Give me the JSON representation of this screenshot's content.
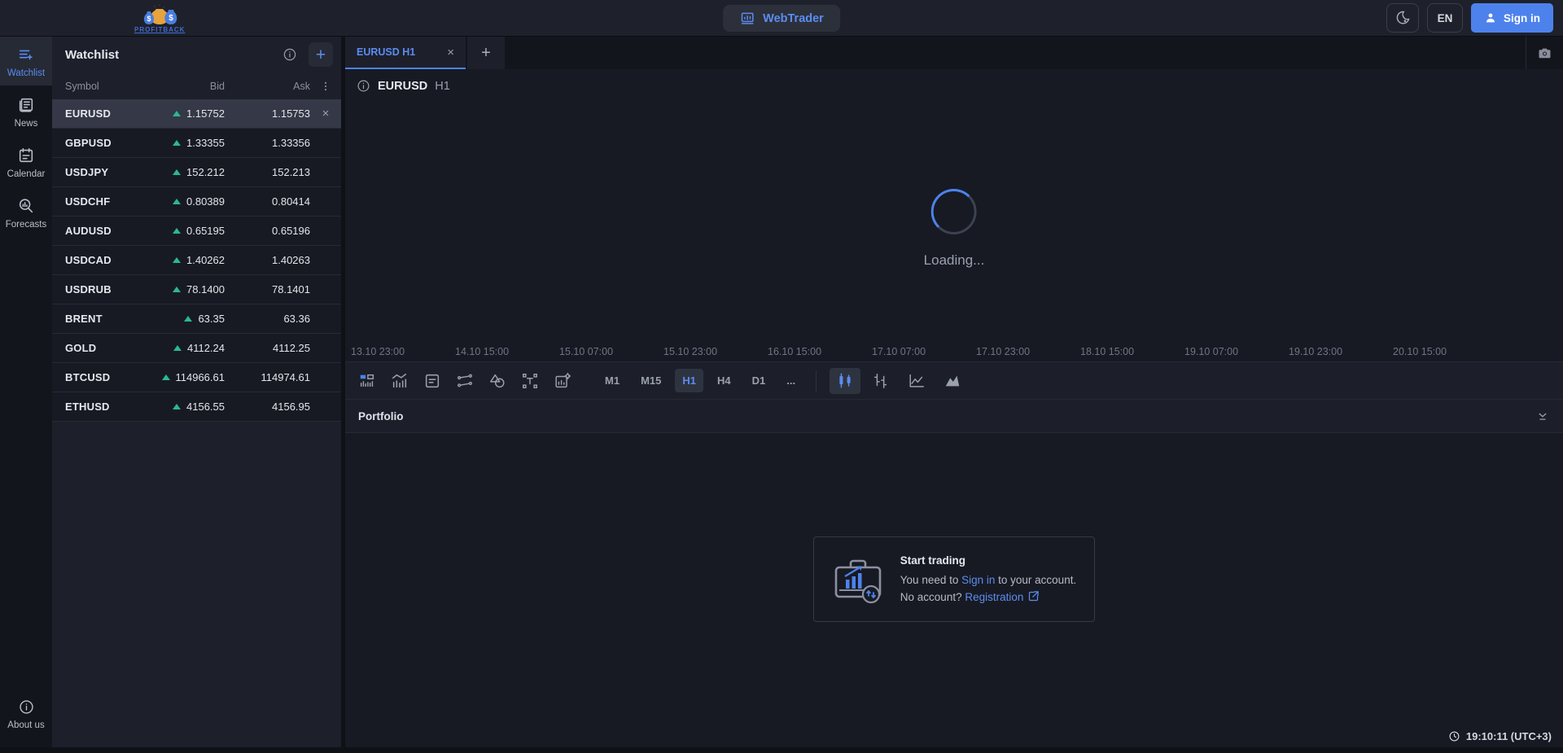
{
  "topbar": {
    "brand_caption": "PROFITBACK",
    "webtrader_label": "WebTrader",
    "language_label": "EN",
    "signin_label": "Sign in"
  },
  "sidebar": {
    "items": [
      {
        "id": "watchlist",
        "label": "Watchlist",
        "active": true
      },
      {
        "id": "news",
        "label": "News",
        "active": false
      },
      {
        "id": "calendar",
        "label": "Calendar",
        "active": false
      },
      {
        "id": "forecasts",
        "label": "Forecasts",
        "active": false
      }
    ],
    "about_label": "About us"
  },
  "watchlist": {
    "title": "Watchlist",
    "columns": {
      "symbol": "Symbol",
      "bid": "Bid",
      "ask": "Ask"
    },
    "rows": [
      {
        "symbol": "EURUSD",
        "bid": "1.15752",
        "ask": "1.15753",
        "direction": "up",
        "selected": true
      },
      {
        "symbol": "GBPUSD",
        "bid": "1.33355",
        "ask": "1.33356",
        "direction": "up",
        "selected": false
      },
      {
        "symbol": "USDJPY",
        "bid": "152.212",
        "ask": "152.213",
        "direction": "up",
        "selected": false
      },
      {
        "symbol": "USDCHF",
        "bid": "0.80389",
        "ask": "0.80414",
        "direction": "up",
        "selected": false
      },
      {
        "symbol": "AUDUSD",
        "bid": "0.65195",
        "ask": "0.65196",
        "direction": "up",
        "selected": false
      },
      {
        "symbol": "USDCAD",
        "bid": "1.40262",
        "ask": "1.40263",
        "direction": "up",
        "selected": false
      },
      {
        "symbol": "USDRUB",
        "bid": "78.1400",
        "ask": "78.1401",
        "direction": "up",
        "selected": false
      },
      {
        "symbol": "BRENT",
        "bid": "63.35",
        "ask": "63.36",
        "direction": "up",
        "selected": false
      },
      {
        "symbol": "GOLD",
        "bid": "4112.24",
        "ask": "4112.25",
        "direction": "up",
        "selected": false
      },
      {
        "symbol": "BTCUSD",
        "bid": "114966.61",
        "ask": "114974.61",
        "direction": "up",
        "selected": false
      },
      {
        "symbol": "ETHUSD",
        "bid": "4156.55",
        "ask": "4156.95",
        "direction": "up",
        "selected": false
      }
    ]
  },
  "chart": {
    "tab_label": "EURUSD H1",
    "symbol": "EURUSD",
    "timeframe_label": "H1",
    "loading_text": "Loading...",
    "x_axis": [
      "13.10 23:00",
      "14.10 15:00",
      "15.10 07:00",
      "15.10 23:00",
      "16.10 15:00",
      "17.10 07:00",
      "17.10 23:00",
      "18.10 15:00",
      "19.10 07:00",
      "19.10 23:00",
      "20.10 15:00"
    ],
    "timeframes": [
      "M1",
      "M15",
      "H1",
      "H4",
      "D1"
    ],
    "selected_timeframe": "H1",
    "more_label": "...",
    "toolbar_tools": [
      "chart-layout",
      "indicators",
      "notes",
      "drawing-lines",
      "shapes",
      "text-tool",
      "chart-settings"
    ],
    "chart_types": [
      "candles",
      "bars",
      "line",
      "area"
    ],
    "selected_chart_type": "candles"
  },
  "portfolio": {
    "title": "Portfolio",
    "start_trading": {
      "title": "Start trading",
      "need_prefix": "You need to ",
      "signin_link": "Sign in",
      "need_suffix": " to your account.",
      "no_account_prefix": "No account? ",
      "registration_link": "Registration"
    }
  },
  "status": {
    "clock": "19:10:11 (UTC+3)"
  },
  "colors": {
    "accent_blue": "#4d82ec",
    "teal_up": "#2bb890",
    "bg_top": "#1e212b",
    "bg_panel": "#1d202b",
    "bg_dark": "#171a23",
    "bg_sidebar": "#13151d",
    "row_selected": "#343847",
    "text_primary": "#e6e8ee",
    "text_muted": "#9aa0ac"
  }
}
